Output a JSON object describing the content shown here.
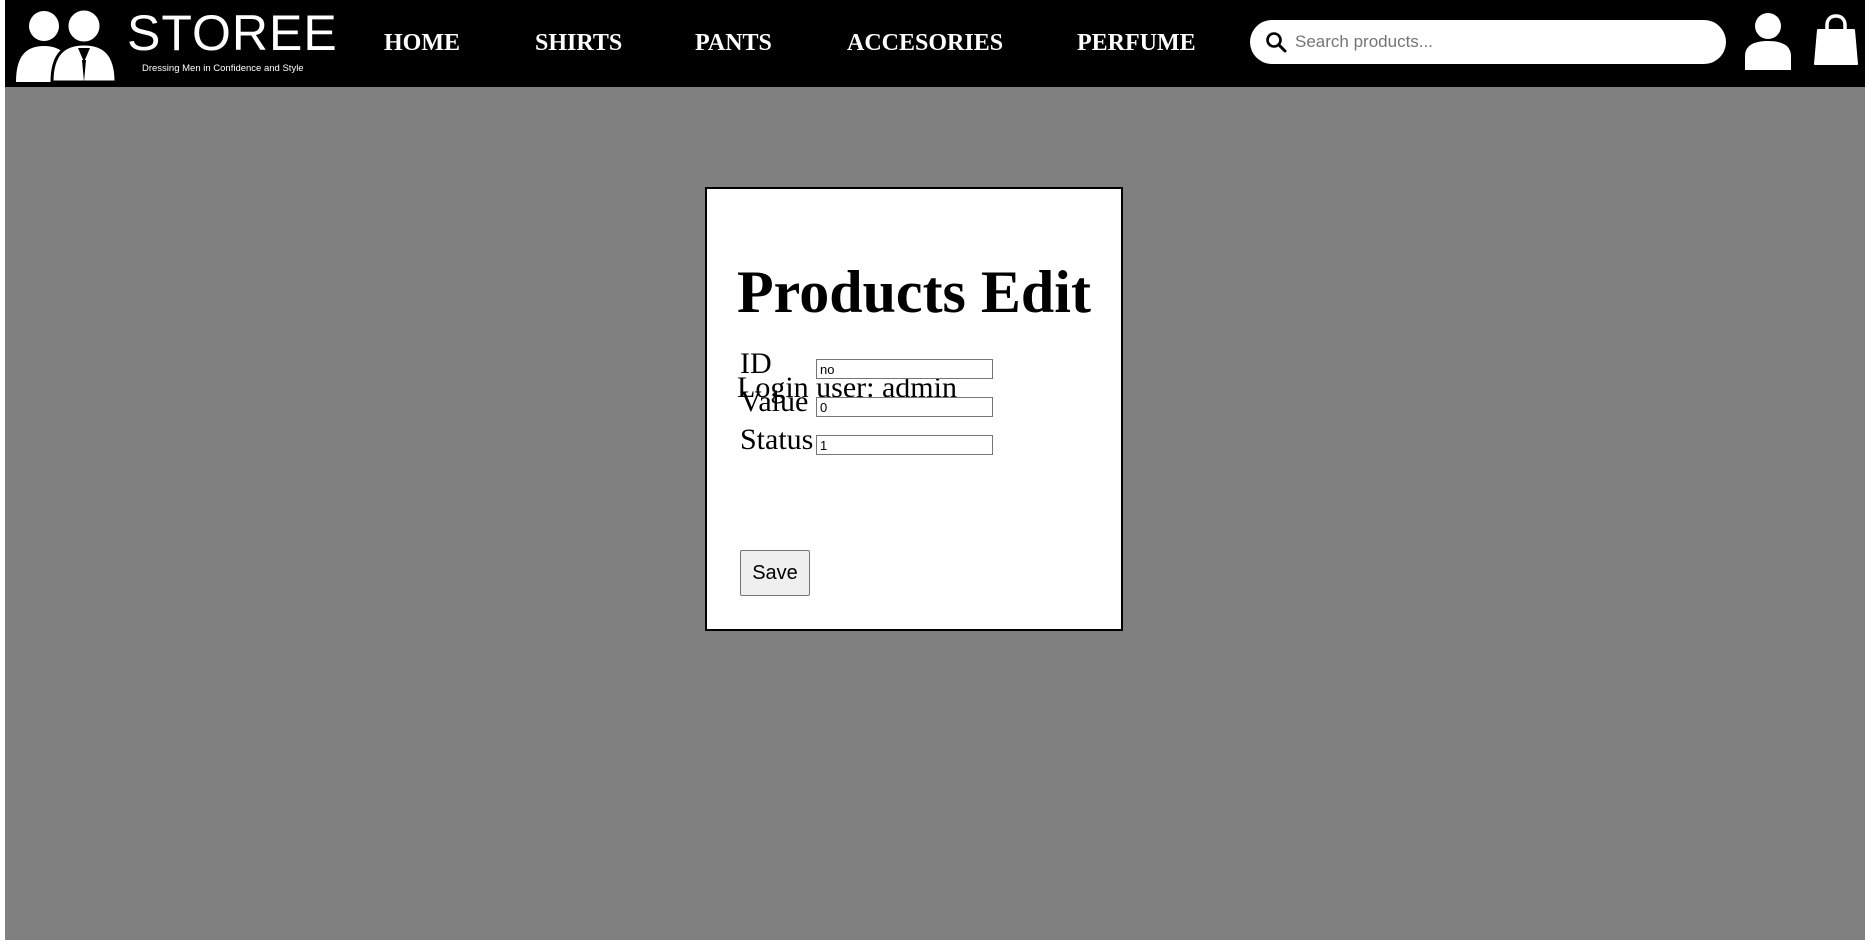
{
  "brand": {
    "name": "STOREE",
    "tagline": "Dressing Men in Confidence and Style"
  },
  "nav": {
    "items": [
      {
        "label": "HOME"
      },
      {
        "label": "SHIRTS"
      },
      {
        "label": "PANTS"
      },
      {
        "label": "ACCESORIES"
      },
      {
        "label": "PERFUME"
      }
    ]
  },
  "search": {
    "placeholder": "Search products...",
    "value": ""
  },
  "icons": {
    "search": "search-icon",
    "user": "user-icon",
    "cart": "shopping-bag-icon",
    "logo": "people-icon"
  },
  "form": {
    "title": "Products Edit",
    "login_text": "Login user: admin",
    "fields": [
      {
        "label": "ID",
        "value": "no"
      },
      {
        "label": "Value",
        "value": "0"
      },
      {
        "label": "Status",
        "value": "1"
      }
    ],
    "save_label": "Save"
  },
  "colors": {
    "header_bg": "#000000",
    "content_bg": "#808080",
    "card_bg": "#ffffff",
    "text_light": "#ffffff",
    "text_dark": "#000000"
  }
}
